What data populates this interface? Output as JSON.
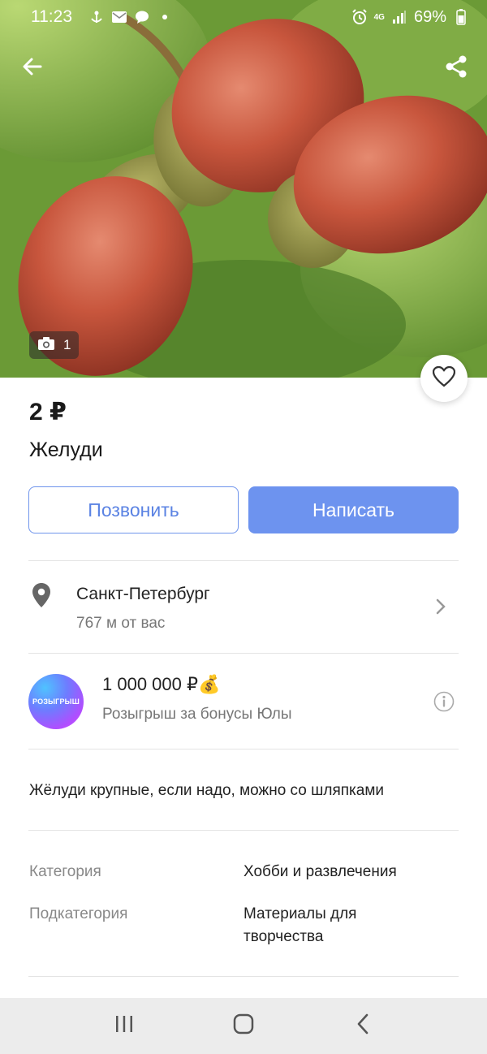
{
  "status_bar": {
    "time": "11:23",
    "battery": "69%",
    "network": "4G"
  },
  "listing": {
    "photo_count": "1",
    "price": "2 ₽",
    "title": "Желуди"
  },
  "actions": {
    "call_label": "Позвонить",
    "write_label": "Написать"
  },
  "location": {
    "city": "Санкт-Петербург",
    "distance": "767 м от вас"
  },
  "promo": {
    "logo_text": "РОЗЫГРЫШ",
    "amount": "1 000 000 ₽💰",
    "subtitle": "Розыгрыш за бонусы Юлы"
  },
  "description": "Жёлуди крупные, если надо, можно со шляпками",
  "specs": [
    {
      "label": "Категория",
      "value": "Хобби и развлечения"
    },
    {
      "label": "Подкатегория",
      "value": "Материалы для творчества"
    }
  ],
  "icons": {
    "back": "arrow-left-icon",
    "share": "share-icon",
    "camera": "camera-icon",
    "favorite": "heart-icon",
    "location": "map-pin-icon",
    "chevron": "chevron-right-icon",
    "info": "info-icon",
    "nav_recent": "recent-apps-icon",
    "nav_home": "home-icon",
    "nav_back": "back-icon"
  },
  "colors": {
    "accent": "#6d93ef",
    "accent_text": "#5b83e3"
  }
}
